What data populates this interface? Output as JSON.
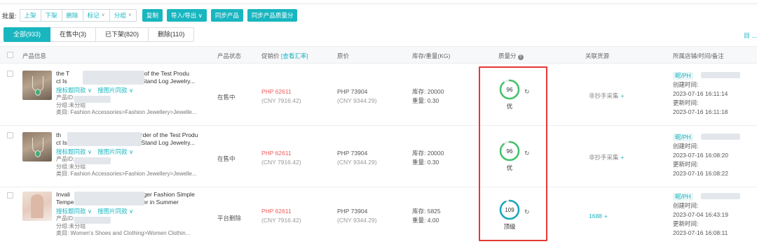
{
  "batch": {
    "label": "批量:",
    "group_buttons": [
      "上架",
      "下架",
      "删除",
      "标记",
      "分组"
    ],
    "copy": "复制",
    "import_export": "导入/导出",
    "sync_products": "同步产品",
    "sync_quality": "同步产品质量分"
  },
  "tabs": [
    {
      "label": "全部(933)",
      "active": true
    },
    {
      "label": "在售中(3)",
      "active": false
    },
    {
      "label": "已下架(820)",
      "active": false
    },
    {
      "label": "删除(110)",
      "active": false
    }
  ],
  "tab_right": "目 ...",
  "columns": {
    "info": "产品信息",
    "status": "产品状态",
    "promo": "促销价",
    "promo_link": "[查看汇率]",
    "price": "原价",
    "stock": "库存/重量(KG)",
    "quality": "质量分",
    "source": "关联货源",
    "store": "所属店铺/时间/备注"
  },
  "rows": [
    {
      "title1": "the T",
      "title1b": "der of the Test Produ",
      "title2": "ct Is",
      "title2b": "Stand Log Jewelry...",
      "kw": "搜标题同款",
      "img": "搜图片同款",
      "pid": "产品ID:",
      "group": "分组:未分组",
      "category": "类目: Fashion Accessories>Fashion Jewellery>Jewelle...",
      "status": "在售中",
      "promo": "PHP 62611",
      "promo_cny": "(CNY 7916.42)",
      "orig": "PHP 73904",
      "orig_cny": "(CNY 9344.29)",
      "stock": "库存: 20000",
      "weight": "重量: 0.30",
      "score": 96,
      "grade": "优",
      "source": "非抄手采集",
      "store_tag": "昵/PH",
      "created_label": "创建时间:",
      "created": "2023-07-16 16:11:14",
      "updated_label": "更新时间:",
      "updated": "2023-07-16 16:11:18"
    },
    {
      "title1": "th",
      "title1b": "e Order of the Test Produ",
      "title2": "ct Is",
      "title2b": "lace Stand Log Jewelry...",
      "kw": "搜标题同款",
      "img": "搜图片同款",
      "pid": "产品ID:",
      "group": "分组:未分组",
      "category": "类目: Fashion Accessories>Fashion Jewellery>Jewelle...",
      "status": "在售中",
      "promo": "PHP 62611",
      "promo_cny": "(CNY 7916.42)",
      "orig": "PHP 73904",
      "orig_cny": "(CNY 9344.29)",
      "stock": "库存: 20000",
      "weight": "重量: 0.30",
      "score": 96,
      "grade": "优",
      "source": "非抄手采集",
      "store_tag": "昵/PH",
      "created_label": "创建时间:",
      "created": "2023-07-16 16:08:20",
      "updated_label": "更新时间:",
      "updated": "2023-07-16 16:08:22"
    },
    {
      "title1": "Invali",
      "title1b": "nger Fashion Simple",
      "title2": "Temperam",
      "title2b": "Sweater in Summer",
      "kw": "搜标题同款",
      "img": "搜图片同款",
      "pid": "产品ID:",
      "group": "分组:未分组",
      "category": "类目: Women's Shoes and Clothing>Women Clothin...",
      "status": "平台删除",
      "promo": "PHP 62611",
      "promo_cny": "(CNY 7916.42)",
      "orig": "PHP 73904",
      "orig_cny": "(CNY 9344.29)",
      "stock": "库存: 5825",
      "weight": "重量: 4.00",
      "score": 109,
      "grade": "顶级",
      "source": "1688",
      "store_tag": "昵/PH",
      "created_label": "创建时间:",
      "created": "2023-07-04 16:43:19",
      "updated_label": "更新时间:",
      "updated": "2023-07-16 16:08:11"
    }
  ],
  "colors": {
    "accent": "#19b6c0",
    "red": "#f05a5a",
    "good": "#44c26b",
    "top": "#19a7b8",
    "highlight": "#e53935"
  }
}
